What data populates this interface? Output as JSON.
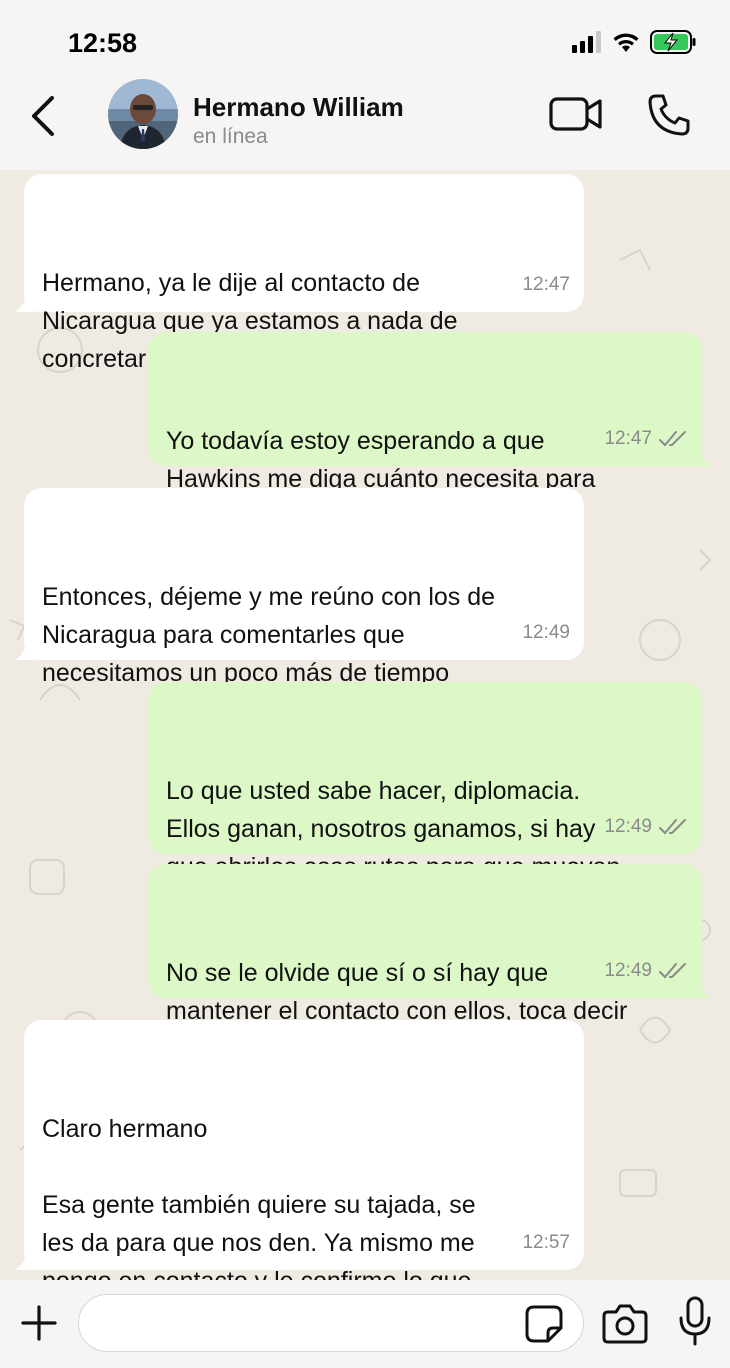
{
  "status_bar": {
    "time": "12:58"
  },
  "header": {
    "contact_name": "Hermano William",
    "contact_status": "en línea",
    "back_icon": "chevron-left-icon",
    "video_icon": "video-camera-icon",
    "call_icon": "phone-icon"
  },
  "messages": [
    {
      "direction": "in",
      "text": "Hermano, ya le dije al contacto de\nNicaragua que ya estamos a nada de\nconcretar",
      "time": "12:47"
    },
    {
      "direction": "out",
      "text": "Yo todavía estoy esperando a que\nHawkins me diga cuánto necesita para\nmover nuestras fichas en la isla",
      "time": "12:47",
      "status": "read"
    },
    {
      "direction": "in",
      "text": "Entonces, déjeme y me reúno con los de\nNicaragua para comentarles que\nnecesitamos un poco más de tiempo",
      "time": "12:49"
    },
    {
      "direction": "out",
      "text": "Lo que usted sabe hacer, diplomacia.\nEllos ganan, nosotros ganamos, si hay\nque abrirles esas rutas para que muevan\nel vicio por la isla, se hace",
      "time": "12:49",
      "status": "read"
    },
    {
      "direction": "out",
      "text": "No se le olvide que sí o sí hay que\nmantener el contacto con ellos, toca decir\nlas cosas con buen tacto",
      "time": "12:49",
      "status": "read"
    },
    {
      "direction": "in",
      "text": "Claro hermano\n\nEsa gente también quiere su tajada, se\nles da para que nos den. Ya mismo me\npongo en contacto y le confirmo lo que\ndigan",
      "time": "12:57"
    }
  ],
  "input_bar": {
    "placeholder": "",
    "icons": [
      "plus-icon",
      "sticker-icon",
      "camera-icon",
      "microphone-icon"
    ]
  },
  "colors": {
    "incoming_bubble": "#ffffff",
    "outgoing_bubble": "#dcf8c6",
    "chat_background": "#efeae2",
    "read_ticks": "#8a8a8a"
  }
}
